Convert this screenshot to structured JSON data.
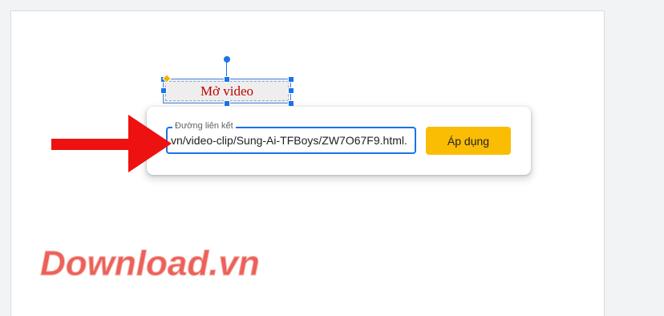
{
  "textbox": {
    "label": "Mở video"
  },
  "link_popup": {
    "field_label": "Đường liên kết",
    "url_value": ".vn/video-clip/Sung-Ai-TFBoys/ZW7O67F9.html",
    "apply_label": "Áp dụng"
  },
  "watermark": {
    "text": "Download.vn"
  },
  "colors": {
    "accent_blue": "#1a73e8",
    "apply_button": "#fbbc04",
    "textbox_text": "#c00000",
    "arrow_red": "#ee1111",
    "watermark_red": "#e8453c"
  }
}
